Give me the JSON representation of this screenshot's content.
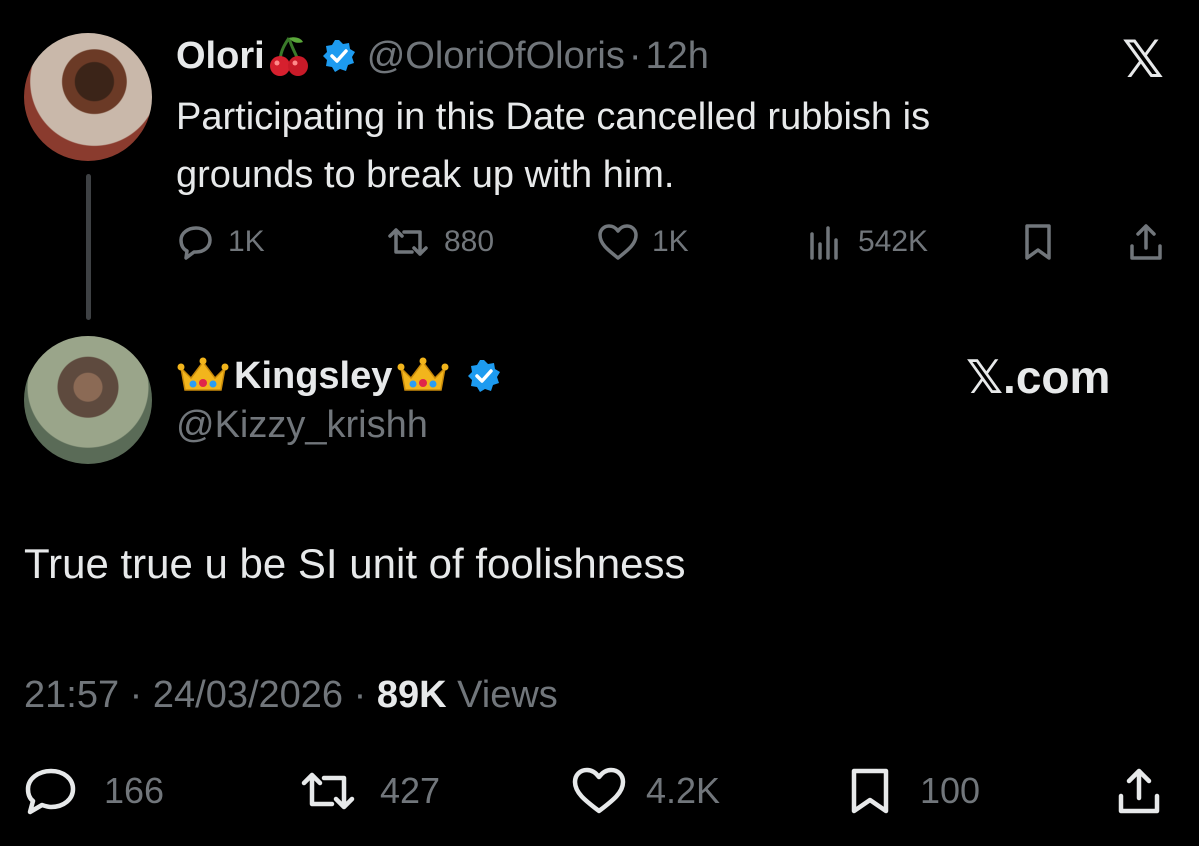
{
  "quoted_tweet": {
    "author_name": "Olori",
    "author_emoji": "cherries-emoji",
    "handle": "@OloriOfOloris",
    "separator": "·",
    "time_ago": "12h",
    "text": "Participating in this Date cancelled rubbish is grounds to break up with him.",
    "replies": "1K",
    "retweets": "880",
    "likes": "1K",
    "views": "542K"
  },
  "reply_tweet": {
    "author_name": "Kingsley",
    "author_emoji": "crown-emoji",
    "handle": "@Kizzy_krishh",
    "text": "True true u be SI unit of foolishness",
    "time": "21:57",
    "date": "24/03/2026",
    "view_count": "89K",
    "views_label": "Views",
    "separator": "·",
    "replies": "166",
    "retweets": "427",
    "likes": "4.2K",
    "bookmarks": "100"
  },
  "branding": {
    "x_logo": "𝕏",
    "x_com": "𝕏.com"
  },
  "colors": {
    "background": "#000000",
    "text_primary": "#e7e9ea",
    "text_secondary": "#71767b",
    "verified_blue": "#1d9bf0"
  }
}
